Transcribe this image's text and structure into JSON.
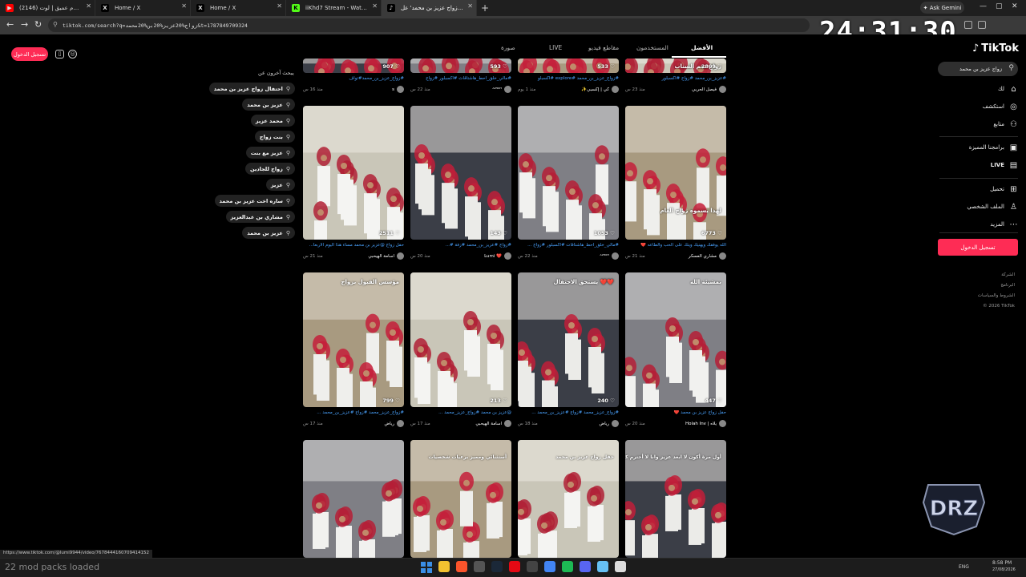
{
  "browser": {
    "tabs": [
      {
        "title": "(2146) كيف أنام نوم عميق | لوت...",
        "favicon": "youtube-icon",
        "color": "#ff0000"
      },
      {
        "title": "Home / X",
        "favicon": "x-icon",
        "color": "#000000"
      },
      {
        "title": "Home / X",
        "favicon": "x-icon",
        "color": "#000000"
      },
      {
        "title": "iiKhd7 Stream - Watch Live on K...",
        "favicon": "kick-icon",
        "color": "#53fc18"
      },
      {
        "title": "اعثر على 'زواج عزيز بن محمد' عل...",
        "favicon": "tiktok-icon",
        "color": "#000000"
      }
    ],
    "ask_gemini": "Ask Gemini",
    "url": "tiktok.com/search?q=زواج%20عزيز%20بن%20محمد&t=1787849709324",
    "overlay_clock": "24:31:30"
  },
  "tiktok": {
    "logo": "TikTok",
    "login_top": "تسجيل الدخول",
    "search_value": "زواج عزيز بن محمد",
    "tabs": [
      "الأفضل",
      "المستخدمون",
      "مقاطع فيديو",
      "LIVE",
      "صورة"
    ],
    "nav": [
      {
        "label": "لك",
        "icon": "home-icon"
      },
      {
        "label": "استكشف",
        "icon": "compass-icon"
      },
      {
        "label": "متابع",
        "icon": "user-plus-icon"
      },
      {
        "label": "برامجنا المميزة",
        "icon": "tv-icon"
      },
      {
        "label": "LIVE",
        "icon": "live-icon"
      },
      {
        "label": "تحميل",
        "icon": "upload-icon"
      },
      {
        "label": "الملف الشخصي",
        "icon": "profile-icon"
      },
      {
        "label": "المزيد",
        "icon": "more-icon"
      }
    ],
    "login_side": "تسجيل الدخول",
    "footer": [
      "الشركة",
      "البرنامج",
      "الشروط والسياسات",
      "© 2026 TikTok"
    ],
    "related_title": "يبحث آخرون عن",
    "related": [
      "احتفال زواج عزيز بن محمد",
      "عزيز بن محمد",
      "محمد عزيز",
      "بنت زواج",
      "عزيز مع بنت",
      "زواج للجادين",
      "عزيز",
      "ساره اخت عزيز بن محمد",
      "مشاري بن عبدالعزيز",
      "عزيز بن محمد"
    ],
    "row0": [
      {
        "likes": "2809",
        "caption": "#عزيز_بن_محمد #زواج #اكسبلور",
        "author": "فيصل الحربي",
        "time": "منذ 23 س",
        "overlay": "زواج نجم السناب"
      },
      {
        "likes": "533",
        "caption": "#زواج_عزيز_بن_محمد #explore #اكسبلو",
        "author": "✨كي | إكسبي",
        "time": "منذ 1 يوم",
        "overlay": ""
      },
      {
        "likes": "593",
        "caption": "#مالي_خلق_احط_هاشتاقات #اكسبلور #زواج",
        "author": "ᴬ²⁵⁰ᴴ",
        "time": "منذ 22 س",
        "overlay": ""
      },
      {
        "likes": "907",
        "caption": "#زواج_عزيز_بن_محمد#تواف",
        "author": "s",
        "time": "منذ 16 س",
        "overlay": ""
      }
    ],
    "row1": [
      {
        "likes": "6773",
        "caption": "الله يوفقك ويهنيك ويتك على الحب والطاعه ❤️",
        "author": "مشاري العسكر",
        "time": "منذ 21 س",
        "overlay": "لهذا يسموه زواج العام"
      },
      {
        "likes": "1053",
        "caption": "#مالي_خلق_احط_هاشتاقات #اكسبلور #زواج ...",
        "author": "ᴬ²⁵⁰ᴴ",
        "time": "منذ 22 س",
        "overlay": ""
      },
      {
        "likes": "143",
        "caption": "#زواج #عزيز_بن_محمد #زفة #...",
        "author": "Lumi ❤️",
        "time": "منذ 20 س",
        "overlay": ""
      },
      {
        "likes": "2511",
        "caption": "حفل زواج @عزيز بن محمد مساء هذا اليوم الاربعا...",
        "author": "اسامة الهيحبي",
        "time": "منذ 21 س",
        "overlay": ""
      }
    ],
    "row2": [
      {
        "likes": "447",
        "caption": "حفل زواج عزيز بن محمد ❤️",
        "author": "Holah Inv | يلاه",
        "time": "منذ 20 س",
        "overlay": "بمشيئة الله"
      },
      {
        "likes": "240",
        "caption": "#زواج_عزيز_محمد #زواج #عزيز_بن_محمد ...",
        "author": "رياض",
        "time": "منذ 18 س",
        "overlay": "يستحق الاحتفال ❤️❤️"
      },
      {
        "likes": "213",
        "caption": "@عزيز بن محمد #زواج_عزيز_محمد ...",
        "author": "اسامة الهيحبي",
        "time": "منذ 17 س",
        "overlay": ""
      },
      {
        "likes": "799",
        "caption": "#زواج_عزيز_محمد #زواج #عزيز_بن_محمد ...",
        "author": "رياض",
        "time": "منذ 17 س",
        "overlay": "مؤسس القبول بزواج"
      }
    ],
    "row3": [
      {
        "overlay": "أول مرة أكون لا ابعد عزيز وانا لا أحترم كثرة وجودة عندنا"
      },
      {
        "overlay": "حفل زواج عزيز بن محمد"
      },
      {
        "overlay": "أستثنائي ومميز برعيات شخصيات"
      },
      {
        "overlay": ""
      }
    ]
  },
  "status_url": "https://www.tiktok.com/@lumi9944/video/7678444160709414152",
  "taskbar": {
    "mod_text": "22 mod packs loaded",
    "time": "8:58 PM",
    "date": "27/08/2026",
    "lang": "ENG"
  }
}
